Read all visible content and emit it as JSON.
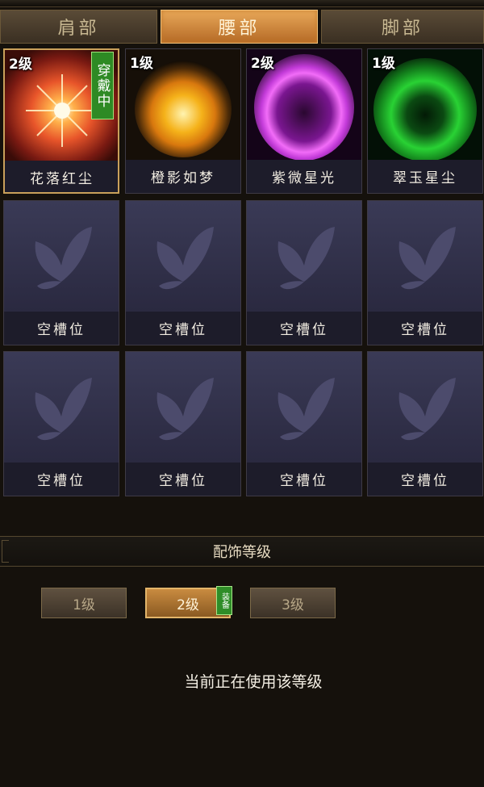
{
  "tabs": [
    {
      "label": "肩部"
    },
    {
      "label": "腰部",
      "active": true
    },
    {
      "label": "脚部"
    }
  ],
  "accessories": [
    {
      "level": "2级",
      "name": "花落红尘",
      "wearing": "穿戴中",
      "color": "#e8552a"
    },
    {
      "level": "1级",
      "name": "橙影如梦",
      "color": "#f0a21a"
    },
    {
      "level": "2级",
      "name": "紫微星光",
      "color": "#c23ad8"
    },
    {
      "level": "1级",
      "name": "翠玉星尘",
      "color": "#29d234"
    }
  ],
  "empty_slot_label": "空槽位",
  "empty_slots": [
    {
      "name": "空槽位"
    },
    {
      "name": "空槽位"
    },
    {
      "name": "空槽位"
    },
    {
      "name": "空槽位"
    },
    {
      "name": "空槽位"
    },
    {
      "name": "空槽位"
    },
    {
      "name": "空槽位"
    },
    {
      "name": "空槽位"
    }
  ],
  "section": {
    "title": "配饰等级"
  },
  "levels": [
    {
      "label": "1级"
    },
    {
      "label": "2级",
      "active": true,
      "badge": "装备"
    },
    {
      "label": "3级"
    }
  ],
  "status_text": "当前正在使用该等级"
}
